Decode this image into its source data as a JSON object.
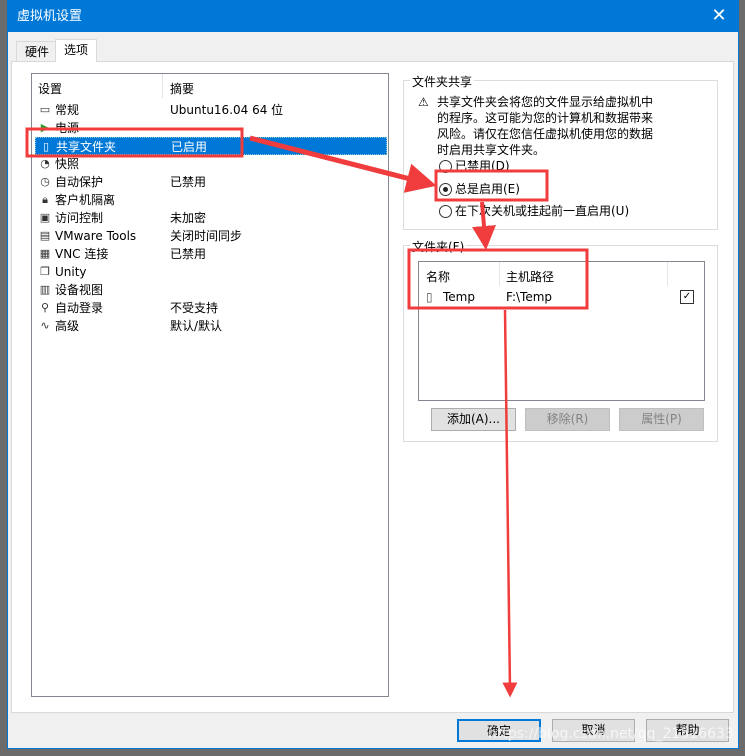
{
  "window": {
    "title": "虚拟机设置"
  },
  "tabs": [
    {
      "label": "硬件"
    },
    {
      "label": "选项",
      "active": true
    }
  ],
  "settings_list": {
    "headers": [
      "设置",
      "摘要"
    ],
    "rows": [
      {
        "icon": "monitor-icon",
        "name": "常规",
        "summary": "Ubuntu16.04 64 位"
      },
      {
        "icon": "power-icon",
        "name": "电源",
        "summary": ""
      },
      {
        "icon": "shared-folder-icon",
        "name": "共享文件夹",
        "summary": "已启用",
        "selected": true
      },
      {
        "icon": "snapshot-icon",
        "name": "快照",
        "summary": ""
      },
      {
        "icon": "autoprotect-icon",
        "name": "自动保护",
        "summary": "已禁用"
      },
      {
        "icon": "lock-icon",
        "name": "客户机隔离",
        "summary": ""
      },
      {
        "icon": "access-control-icon",
        "name": "访问控制",
        "summary": "未加密"
      },
      {
        "icon": "vm-icon",
        "name": "VMware Tools",
        "summary": "关闭时间同步"
      },
      {
        "icon": "vnc-icon",
        "name": "VNC 连接",
        "summary": "已禁用"
      },
      {
        "icon": "unity-icon",
        "name": "Unity",
        "summary": ""
      },
      {
        "icon": "device-view-icon",
        "name": "设备视图",
        "summary": ""
      },
      {
        "icon": "autologin-icon",
        "name": "自动登录",
        "summary": "不受支持"
      },
      {
        "icon": "advanced-icon",
        "name": "高级",
        "summary": "默认/默认"
      }
    ]
  },
  "folder_sharing": {
    "label": "文件夹共享",
    "warning": "共享文件夹会将您的文件显示给虚拟机中的程序。这可能为您的计算机和数据带来风险。请仅在您信任虚拟机使用您的数据时启用共享文件夹。",
    "options": [
      {
        "label": "已禁用(D)",
        "checked": false
      },
      {
        "label": "总是启用(E)",
        "checked": true
      },
      {
        "label": "在下次关机或挂起前一直启用(U)",
        "checked": false
      }
    ]
  },
  "folders": {
    "label": "文件夹(F)",
    "headers": [
      "名称",
      "主机路径"
    ],
    "rows": [
      {
        "name": "Temp",
        "path": "F:\\Temp",
        "enabled": true
      }
    ],
    "buttons": {
      "add": "添加(A)...",
      "remove": "移除(R)",
      "properties": "属性(P)"
    }
  },
  "footer": {
    "ok": "确定",
    "cancel": "取消",
    "help": "帮助"
  },
  "watermark": "https://blog.csdn.net/qq_21516633",
  "colors": {
    "accent": "#0078d7",
    "annotation": "#f03c3c"
  }
}
